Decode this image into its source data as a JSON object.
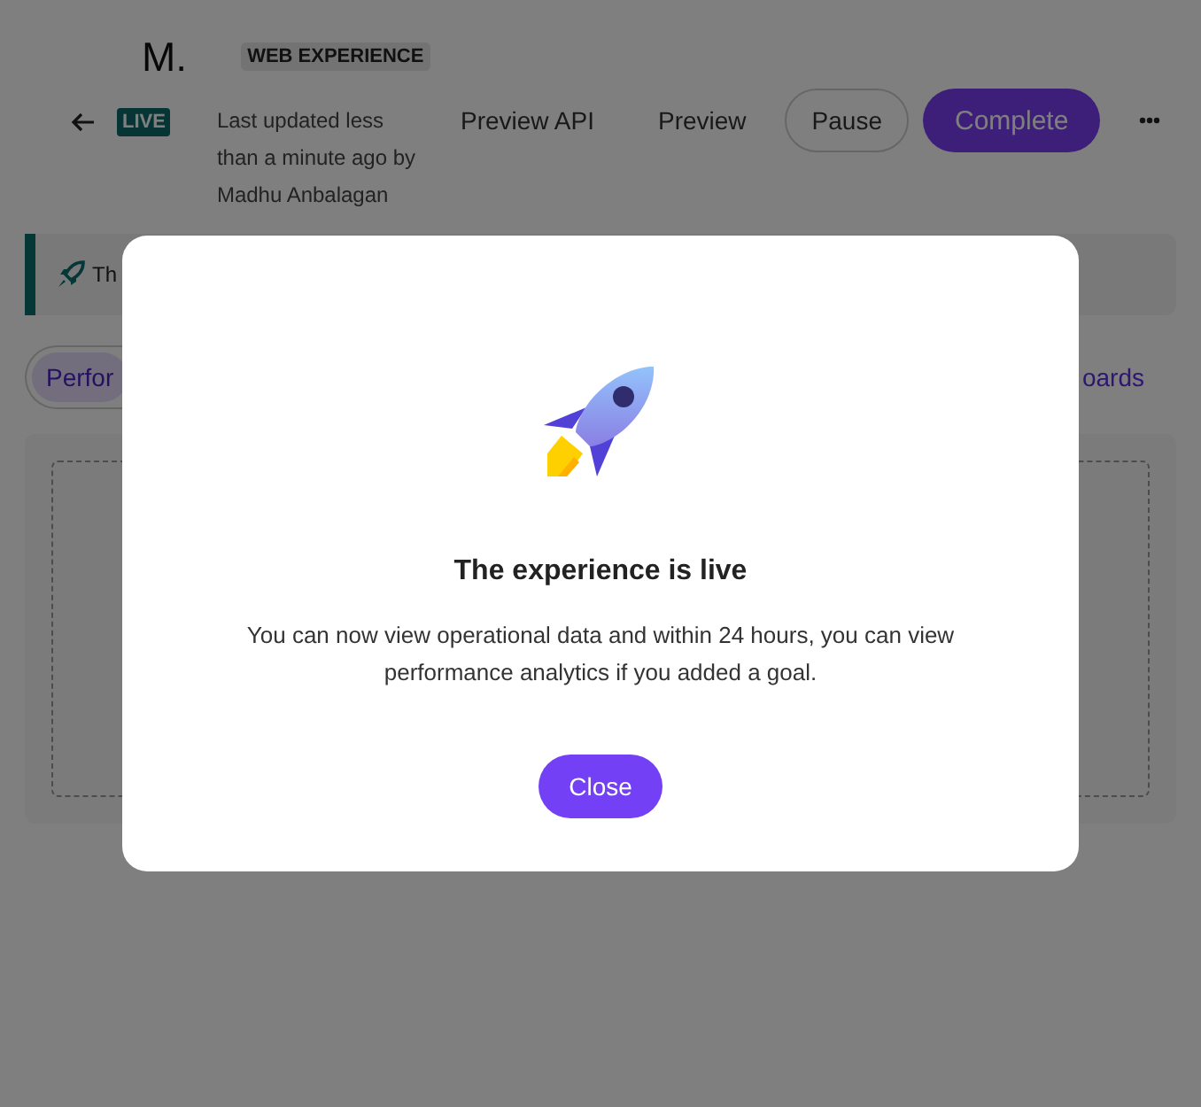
{
  "header": {
    "title": "M.",
    "type_badge": "WEB EXPERIENCE",
    "status": "LIVE",
    "updated": "Last updated less than a minute ago by Madhu Anbalagan",
    "actions": [
      {
        "kind": "link",
        "label": "Preview API"
      },
      {
        "kind": "link",
        "label": "Preview"
      },
      {
        "kind": "outline",
        "label": "Pause"
      },
      {
        "kind": "primary",
        "label": "Complete"
      },
      {
        "kind": "more"
      }
    ]
  },
  "banner": {
    "text": "Th"
  },
  "tabs": [
    {
      "label": "Perfor",
      "selected": true
    }
  ],
  "dashboards_link": "oards",
  "modal": {
    "title": "The experience is live",
    "body": "You can now view operational data and within 24 hours, you can view performance analytics if you added a goal.",
    "button": "Close"
  }
}
